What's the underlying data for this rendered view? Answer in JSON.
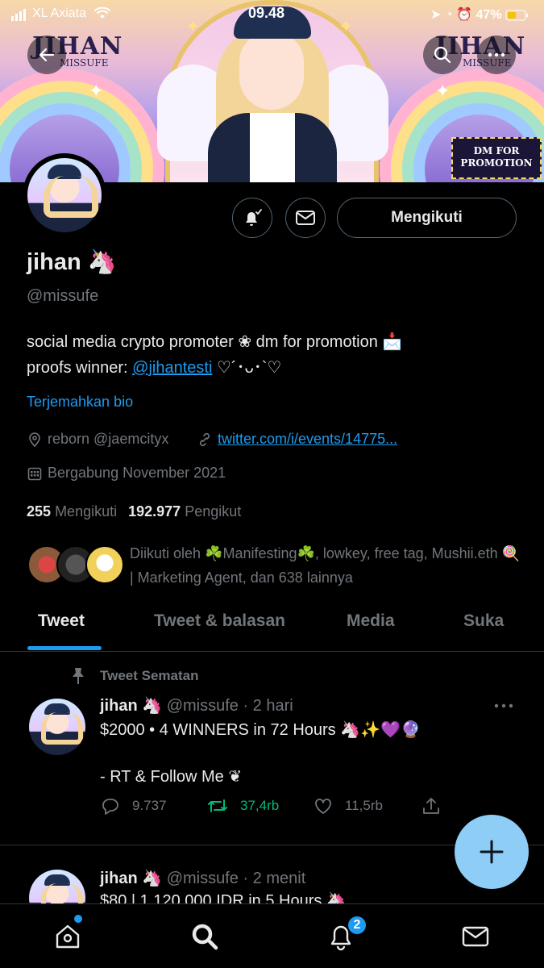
{
  "status_bar": {
    "carrier": "XL Axiata",
    "time": "09.48",
    "battery": "47%"
  },
  "banner": {
    "logo_left": "JIHAN",
    "logo_left_sub": "MISSUFE",
    "logo_right": "JIHAN",
    "logo_right_sub": "MISSUFE",
    "badge_line1": "DM FOR",
    "badge_line2": "PROMOTION"
  },
  "profile": {
    "name": "jihan 🦄",
    "handle": "@missufe",
    "bio_line1": "social media crypto promoter ❀ dm for promotion 📩",
    "bio_line2_prefix": "proofs winner: ",
    "bio_mention": "@jihantesti",
    "bio_line2_suffix": " ♡´･ᴗ･`♡",
    "translate": "Terjemahkan bio",
    "location": "reborn @jaemcityx",
    "link": "twitter.com/i/events/14775...",
    "joined": "Bergabung November 2021",
    "following_count": "255",
    "following_label": "Mengikuti",
    "followers_count": "192.977",
    "followers_label": "Pengikut",
    "followed_by": "Diikuti oleh ☘️Manifesting☘️, lowkey, free tag, Mushii.eth 🍭 | Marketing Agent, dan 638 lainnya",
    "follow_button": "Mengikuti"
  },
  "tabs": [
    {
      "label": "Tweet"
    },
    {
      "label": "Tweet & balasan"
    },
    {
      "label": "Media"
    },
    {
      "label": "Suka"
    }
  ],
  "tweets": [
    {
      "pinned_label": "Tweet Sematan",
      "name": "jihan 🦄",
      "meta": " @missufe · 2 hari",
      "line1": "$2000 • 4 WINNERS in 72 Hours 🦄✨💜🔮",
      "line2": "- RT & Follow Me ❦",
      "replies": "9.737",
      "retweets": "37,4rb",
      "likes": "11,5rb"
    },
    {
      "name": "jihan 🦄",
      "meta": " @missufe · 2 menit",
      "line1": "$80 | 1.120.000 IDR in 5 Hours 🦄"
    }
  ],
  "bottom_nav": {
    "notifications_badge": "2"
  },
  "colors": {
    "accent": "#1d9bf0",
    "retweet": "#00ba7c",
    "muted": "#71767b",
    "fab": "#8ecdf5"
  },
  "icons": [
    "back-arrow-icon",
    "search-icon",
    "more-icon",
    "bell-check-icon",
    "mail-icon",
    "location-icon",
    "link-icon",
    "calendar-icon",
    "pin-icon",
    "reply-icon",
    "retweet-icon",
    "heart-icon",
    "share-icon",
    "plus-icon",
    "home-icon",
    "bell-icon"
  ]
}
